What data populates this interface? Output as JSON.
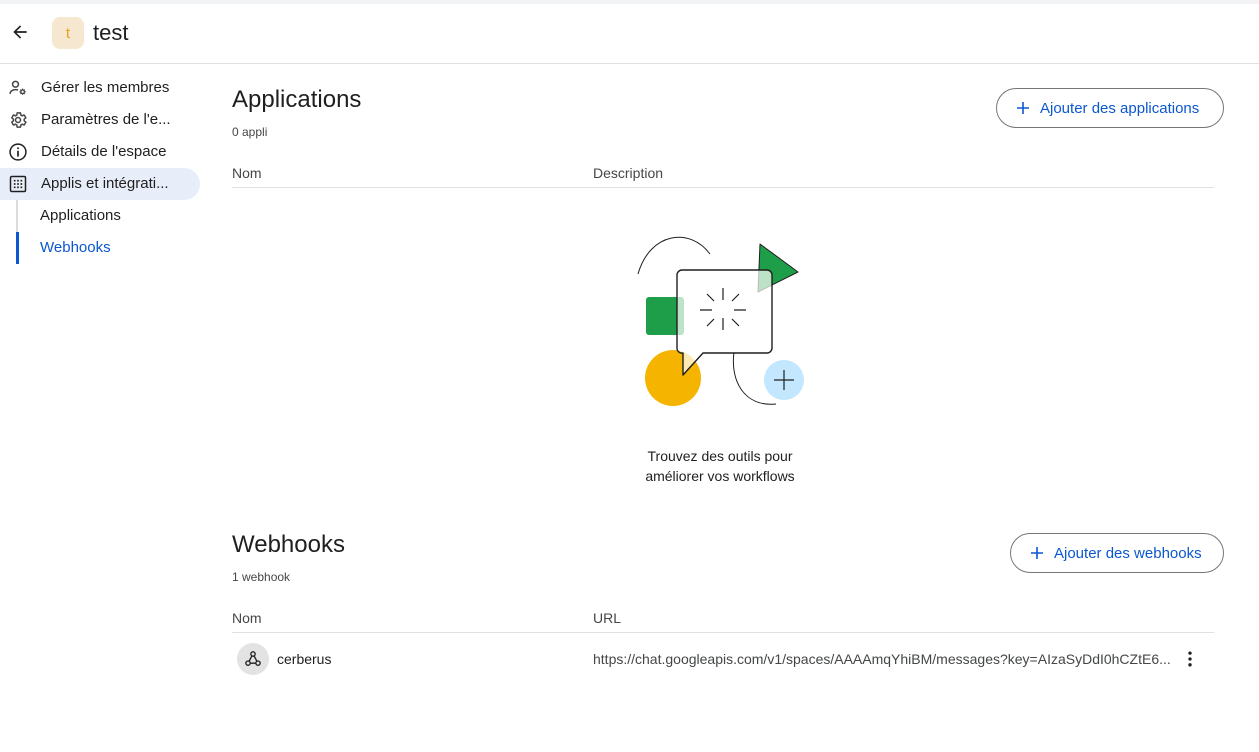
{
  "header": {
    "space_initial": "t",
    "space_name": "test"
  },
  "sidebar": {
    "items": [
      {
        "label": "Gérer les membres",
        "icon": "manage-members-icon"
      },
      {
        "label": "Paramètres de l'e...",
        "icon": "gear-icon"
      },
      {
        "label": "Détails de l'espace",
        "icon": "info-icon"
      },
      {
        "label": "Applis et intégrati...",
        "icon": "apps-grid-icon",
        "active": true
      }
    ],
    "sub_items": [
      {
        "label": "Applications"
      },
      {
        "label": "Webhooks",
        "active": true
      }
    ]
  },
  "applications": {
    "title": "Applications",
    "count": "0 appli",
    "add_button": "Ajouter des applications",
    "columns": [
      "Nom",
      "Description"
    ],
    "empty_line1": "Trouvez des outils pour",
    "empty_line2": "améliorer vos workflows"
  },
  "webhooks": {
    "title": "Webhooks",
    "count": "1 webhook",
    "add_button": "Ajouter des webhooks",
    "columns": [
      "Nom",
      "URL"
    ],
    "rows": [
      {
        "name": "cerberus",
        "url": "https://chat.googleapis.com/v1/spaces/AAAAmqYhiBM/messages?key=AIzaSyDdI0hCZtE6..."
      }
    ]
  },
  "colors": {
    "accent": "#0b57d0",
    "active_bg": "#e8eef9",
    "green": "#1e9e48",
    "yellow": "#f4b400",
    "light_blue": "#c2e7ff"
  }
}
